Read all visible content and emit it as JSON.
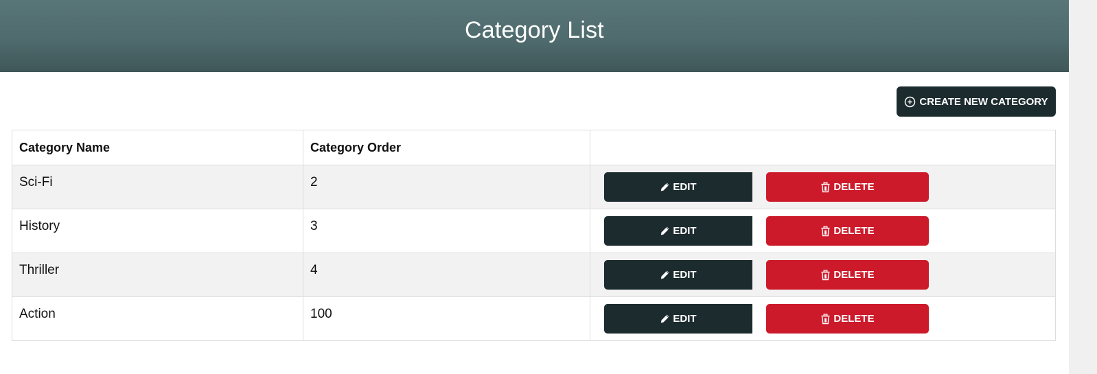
{
  "header": {
    "title": "Category List"
  },
  "toolbar": {
    "create_label": "CREATE NEW CATEGORY",
    "create_icon": "plus-circle-icon"
  },
  "table": {
    "headers": [
      "Category Name",
      "Category Order",
      ""
    ],
    "rows": [
      {
        "name": "Sci-Fi",
        "order": "2"
      },
      {
        "name": "History",
        "order": "3"
      },
      {
        "name": "Thriller",
        "order": "4"
      },
      {
        "name": "Action",
        "order": "100"
      }
    ],
    "edit_label": "EDIT",
    "edit_icon": "pencil-icon",
    "delete_label": "DELETE",
    "delete_icon": "trash-icon"
  },
  "colors": {
    "header_gradient_top": "#587577",
    "header_gradient_bottom": "#3f5759",
    "dark_button": "#1c2b2e",
    "danger_button": "#cc1a2b",
    "striped_row": "#f2f2f2"
  }
}
